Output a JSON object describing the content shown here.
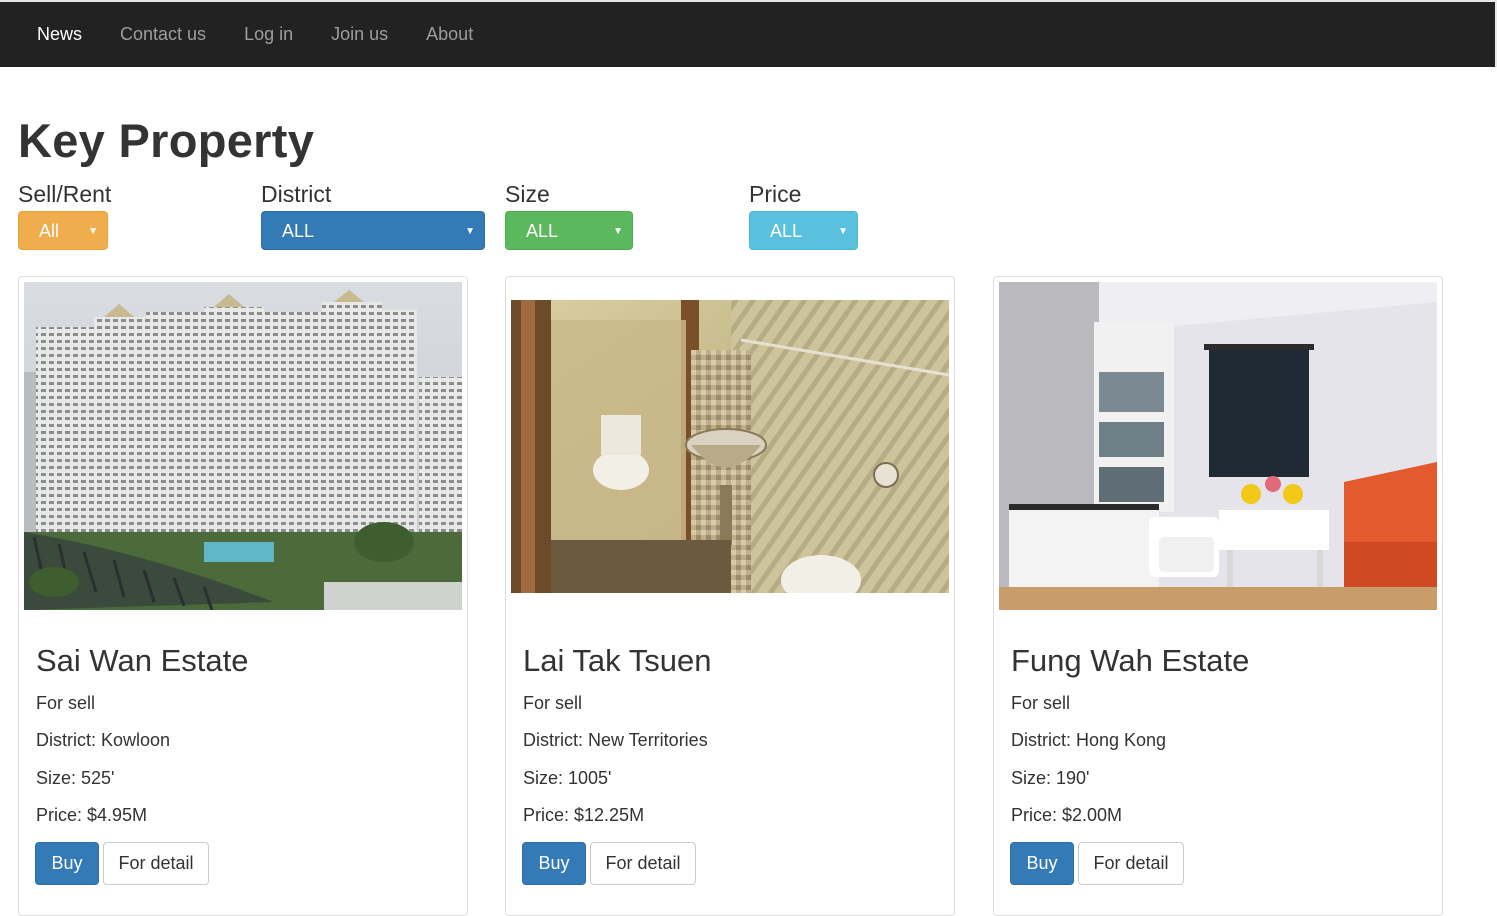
{
  "nav": {
    "items": [
      {
        "label": "News",
        "active": true
      },
      {
        "label": "Contact us"
      },
      {
        "label": "Log in"
      },
      {
        "label": "Join us"
      },
      {
        "label": "About"
      }
    ]
  },
  "page": {
    "title": "Key Property"
  },
  "filters": {
    "sell_rent": {
      "label": "Sell/Rent",
      "value": "All",
      "color": "#f0ad4e"
    },
    "district": {
      "label": "District",
      "value": "ALL",
      "color": "#337ab7"
    },
    "size": {
      "label": "Size",
      "value": "ALL",
      "color": "#5cb85c"
    },
    "price": {
      "label": "Price",
      "value": "ALL",
      "color": "#5bc0de"
    }
  },
  "listings": [
    {
      "name": "Sai Wan Estate",
      "type": "For sell",
      "district": "District: Kowloon",
      "size": "Size: 525'",
      "price": "Price: $4.95M",
      "buy_label": "Buy",
      "detail_label": "For detail"
    },
    {
      "name": "Lai Tak Tsuen",
      "type": "For sell",
      "district": "District: New Territories",
      "size": "Size: 1005'",
      "price": "Price: $12.25M",
      "buy_label": "Buy",
      "detail_label": "For detail"
    },
    {
      "name": "Fung Wah Estate",
      "type": "For sell",
      "district": "District: Hong Kong",
      "size": "Size: 190'",
      "price": "Price: $2.00M",
      "buy_label": "Buy",
      "detail_label": "For detail"
    }
  ]
}
